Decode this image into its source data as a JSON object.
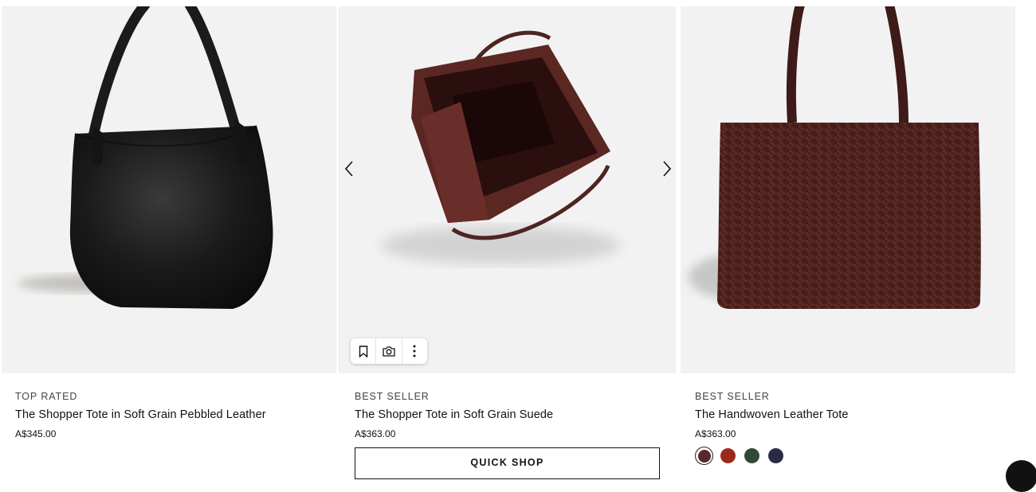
{
  "products": [
    {
      "badge": "TOP RATED",
      "name": "The Shopper Tote in Soft Grain Pebbled Leather",
      "price": "A$345.00",
      "image": "black-pebbled-leather-tote",
      "color": "#151515"
    },
    {
      "badge": "BEST SELLER",
      "name": "The Shopper Tote in Soft Grain Suede",
      "price": "A$363.00",
      "image": "burgundy-suede-tote-open-view",
      "color": "#4a1c18",
      "quick_shop_label": "QUICK SHOP"
    },
    {
      "badge": "BEST SELLER",
      "name": "The Handwoven Leather Tote",
      "price": "A$363.00",
      "image": "brown-woven-leather-tote",
      "color": "#46201c",
      "swatches": [
        {
          "name": "burgundy",
          "color": "#5a2a2a",
          "selected": true
        },
        {
          "name": "red",
          "color": "#9c2a1c",
          "selected": false
        },
        {
          "name": "green",
          "color": "#2f4a3a",
          "selected": false
        },
        {
          "name": "navy",
          "color": "#2a2c44",
          "selected": false
        }
      ]
    }
  ],
  "carousel": {
    "prev_icon": "chevron-left-icon",
    "next_icon": "chevron-right-icon"
  },
  "toolbar": {
    "icons": [
      "bookmark-icon",
      "camera-icon",
      "more-vertical-icon"
    ]
  },
  "chat": {
    "icon": "chat-icon"
  }
}
